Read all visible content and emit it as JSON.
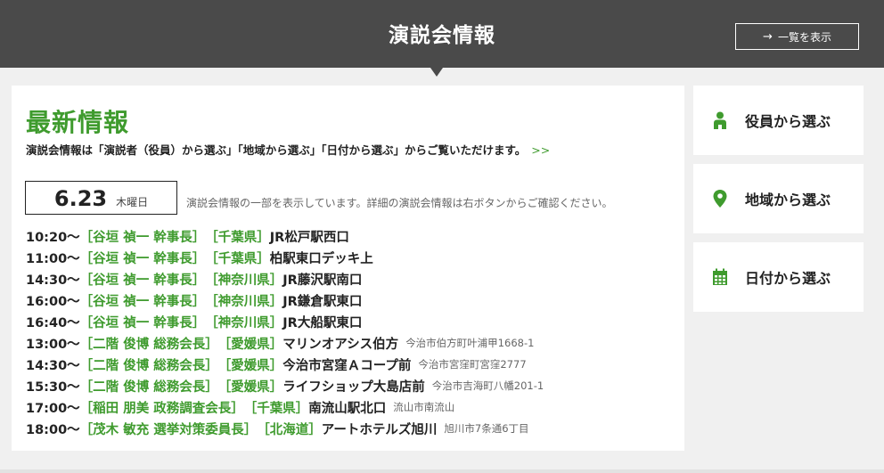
{
  "header": {
    "title": "演説会情報",
    "list_button_label": "一覧を表示",
    "list_button_arrow": "→"
  },
  "main": {
    "title": "最新情報",
    "description": "演説会情報は「演説者（役員）から選ぶ」「地域から選ぶ」「日付から選ぶ」からご覧いただけます。",
    "description_more": ">>",
    "date": "6.23",
    "weekday": "木曜日",
    "date_note": "演説会情報の一部を表示しています。詳細の演説会情報は右ボタンからご確認ください。",
    "events": [
      {
        "time": "10:20〜",
        "speaker": "［谷垣 禎一 幹事長］",
        "pref": "［千葉県］",
        "place": "JR松戸駅西口",
        "address": ""
      },
      {
        "time": "11:00〜",
        "speaker": "［谷垣 禎一 幹事長］",
        "pref": "［千葉県］",
        "place": "柏駅東口デッキ上",
        "address": ""
      },
      {
        "time": "14:30〜",
        "speaker": "［谷垣 禎一 幹事長］",
        "pref": "［神奈川県］",
        "place": "JR藤沢駅南口",
        "address": ""
      },
      {
        "time": "16:00〜",
        "speaker": "［谷垣 禎一 幹事長］",
        "pref": "［神奈川県］",
        "place": "JR鎌倉駅東口",
        "address": ""
      },
      {
        "time": "16:40〜",
        "speaker": "［谷垣 禎一 幹事長］",
        "pref": "［神奈川県］",
        "place": "JR大船駅東口",
        "address": ""
      },
      {
        "time": "13:00〜",
        "speaker": "［二階 俊博 総務会長］",
        "pref": "［愛媛県］",
        "place": "マリンオアシス伯方",
        "address": "今治市伯方町叶浦甲1668-1"
      },
      {
        "time": "14:30〜",
        "speaker": "［二階 俊博 総務会長］",
        "pref": "［愛媛県］",
        "place": "今治市宮窪Ａコープ前",
        "address": "今治市宮窪町宮窪2777"
      },
      {
        "time": "15:30〜",
        "speaker": "［二階 俊博 総務会長］",
        "pref": "［愛媛県］",
        "place": "ライフショップ大島店前",
        "address": "今治市吉海町八幡201-1"
      },
      {
        "time": "17:00〜",
        "speaker": "［稲田 朋美 政務調査会長］",
        "pref": "［千葉県］",
        "place": "南流山駅北口",
        "address": "流山市南流山"
      },
      {
        "time": "18:00〜",
        "speaker": "［茂木 敏充 選挙対策委員長］",
        "pref": "［北海道］",
        "place": "アートホテルズ旭川",
        "address": "旭川市7条通6丁目"
      }
    ]
  },
  "sidebar": {
    "items": [
      {
        "label": "役員から選ぶ",
        "icon": "person-icon"
      },
      {
        "label": "地域から選ぶ",
        "icon": "map-pin-icon"
      },
      {
        "label": "日付から選ぶ",
        "icon": "calendar-icon"
      }
    ]
  },
  "colors": {
    "accent": "#3f9b2e",
    "header_bg": "#4a4a4a",
    "page_bg": "#f0f0f0"
  }
}
